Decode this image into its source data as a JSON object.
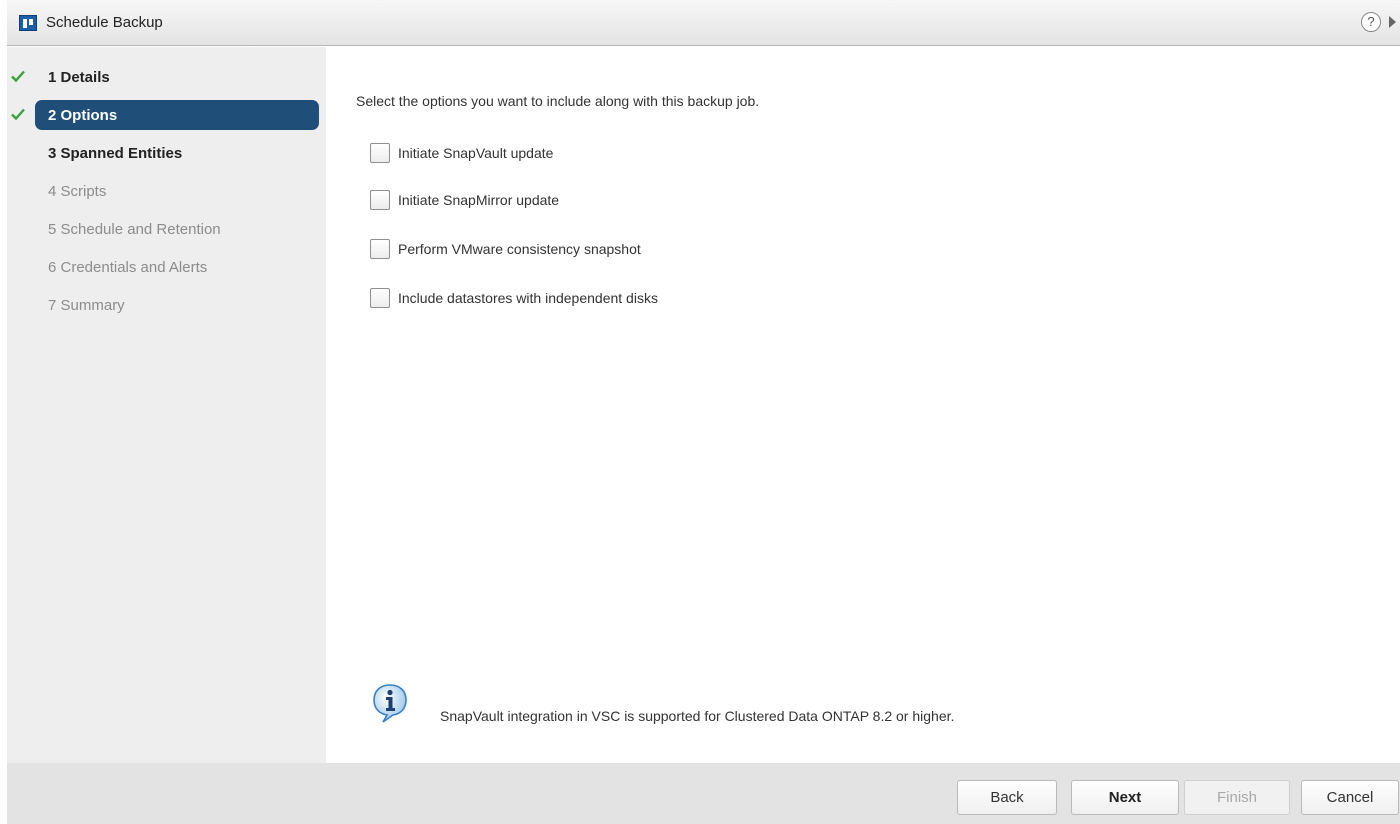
{
  "window": {
    "title": "Schedule Backup",
    "app_icon": "vsc-app-icon",
    "help_label": "?",
    "help_icon": "help-icon",
    "expand_icon": "chevron-right-icon"
  },
  "steps": [
    {
      "label": "1 Details",
      "state": "completed"
    },
    {
      "label": "2 Options",
      "state": "active, completed"
    },
    {
      "label": "3 Spanned Entities",
      "state": "next"
    },
    {
      "label": "4 Scripts",
      "state": "pending"
    },
    {
      "label": "5 Schedule and Retention",
      "state": "pending"
    },
    {
      "label": "6 Credentials and Alerts",
      "state": "pending"
    },
    {
      "label": "7 Summary",
      "state": "pending"
    }
  ],
  "content": {
    "intro": "Select the options you want to include along with this backup job.",
    "options": [
      {
        "label": "Initiate SnapVault update",
        "checked": false
      },
      {
        "label": "Initiate SnapMirror update",
        "checked": false
      },
      {
        "label": "Perform VMware consistency snapshot",
        "checked": false
      },
      {
        "label": "Include datastores with independent disks",
        "checked": false
      }
    ],
    "info_icon": "info-icon",
    "info_text": "SnapVault integration in VSC is supported for Clustered Data ONTAP 8.2 or higher."
  },
  "footer": {
    "back_label": "Back",
    "next_label": "Next",
    "finish_label": "Finish",
    "cancel_label": "Cancel"
  },
  "colors": {
    "active_step_bg": "#1f4e79",
    "check_green": "#3aa03a",
    "sidebar_bg": "#eeeeee",
    "footer_bg": "#e3e3e3"
  }
}
